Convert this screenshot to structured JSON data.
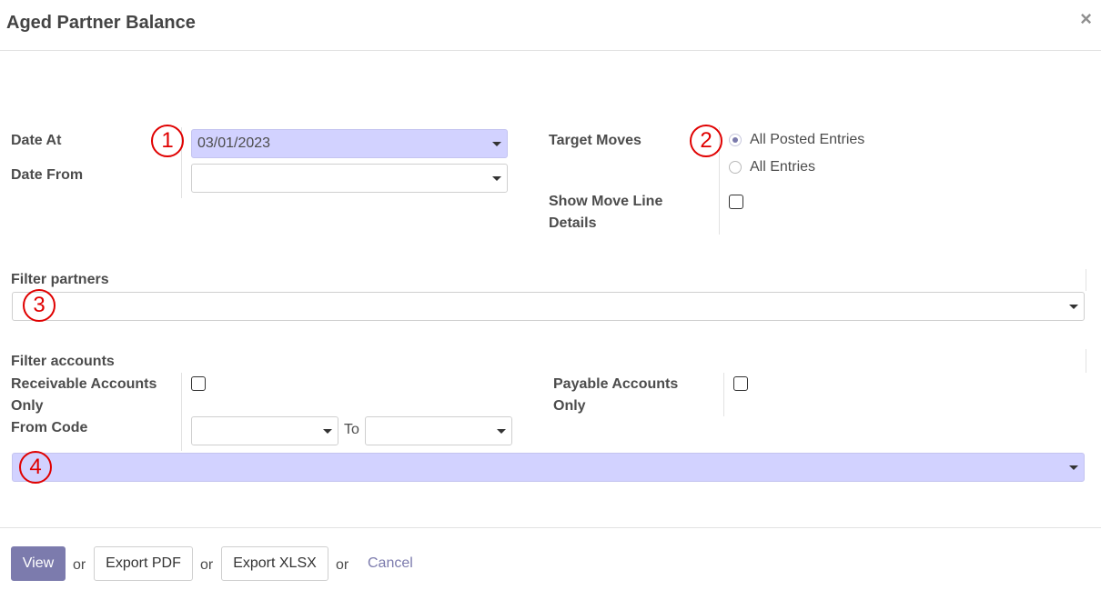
{
  "dialog": {
    "title": "Aged Partner Balance",
    "close_glyph": "×"
  },
  "fields": {
    "date_at": {
      "label": "Date At",
      "value": "03/01/2023"
    },
    "date_from": {
      "label": "Date From",
      "value": ""
    },
    "target_moves": {
      "label": "Target Moves",
      "options": [
        "All Posted Entries",
        "All Entries"
      ],
      "selected": "All Posted Entries"
    },
    "show_move_line_details": {
      "label_line1": "Show Move Line",
      "label_line2": "Details",
      "checked": false
    },
    "filter_partners": {
      "label": "Filter partners",
      "value": ""
    },
    "filter_accounts": {
      "label": "Filter accounts"
    },
    "receivable_only": {
      "label_line1": "Receivable Accounts",
      "label_line2": "Only",
      "checked": false
    },
    "payable_only": {
      "label_line1": "Payable Accounts",
      "label_line2": "Only",
      "checked": false
    },
    "from_code": {
      "label": "From Code",
      "value": "",
      "to_label": "To",
      "to_value": ""
    },
    "accounts": {
      "value": ""
    }
  },
  "markers": [
    "1",
    "2",
    "3",
    "4"
  ],
  "footer": {
    "view_label": "View",
    "or_label": "or",
    "export_pdf_label": "Export PDF",
    "export_xlsx_label": "Export XLSX",
    "cancel_label": "Cancel"
  },
  "colors": {
    "primary": "#7c7bad",
    "highlight": "#d2d2ff",
    "marker": "#e00000"
  }
}
